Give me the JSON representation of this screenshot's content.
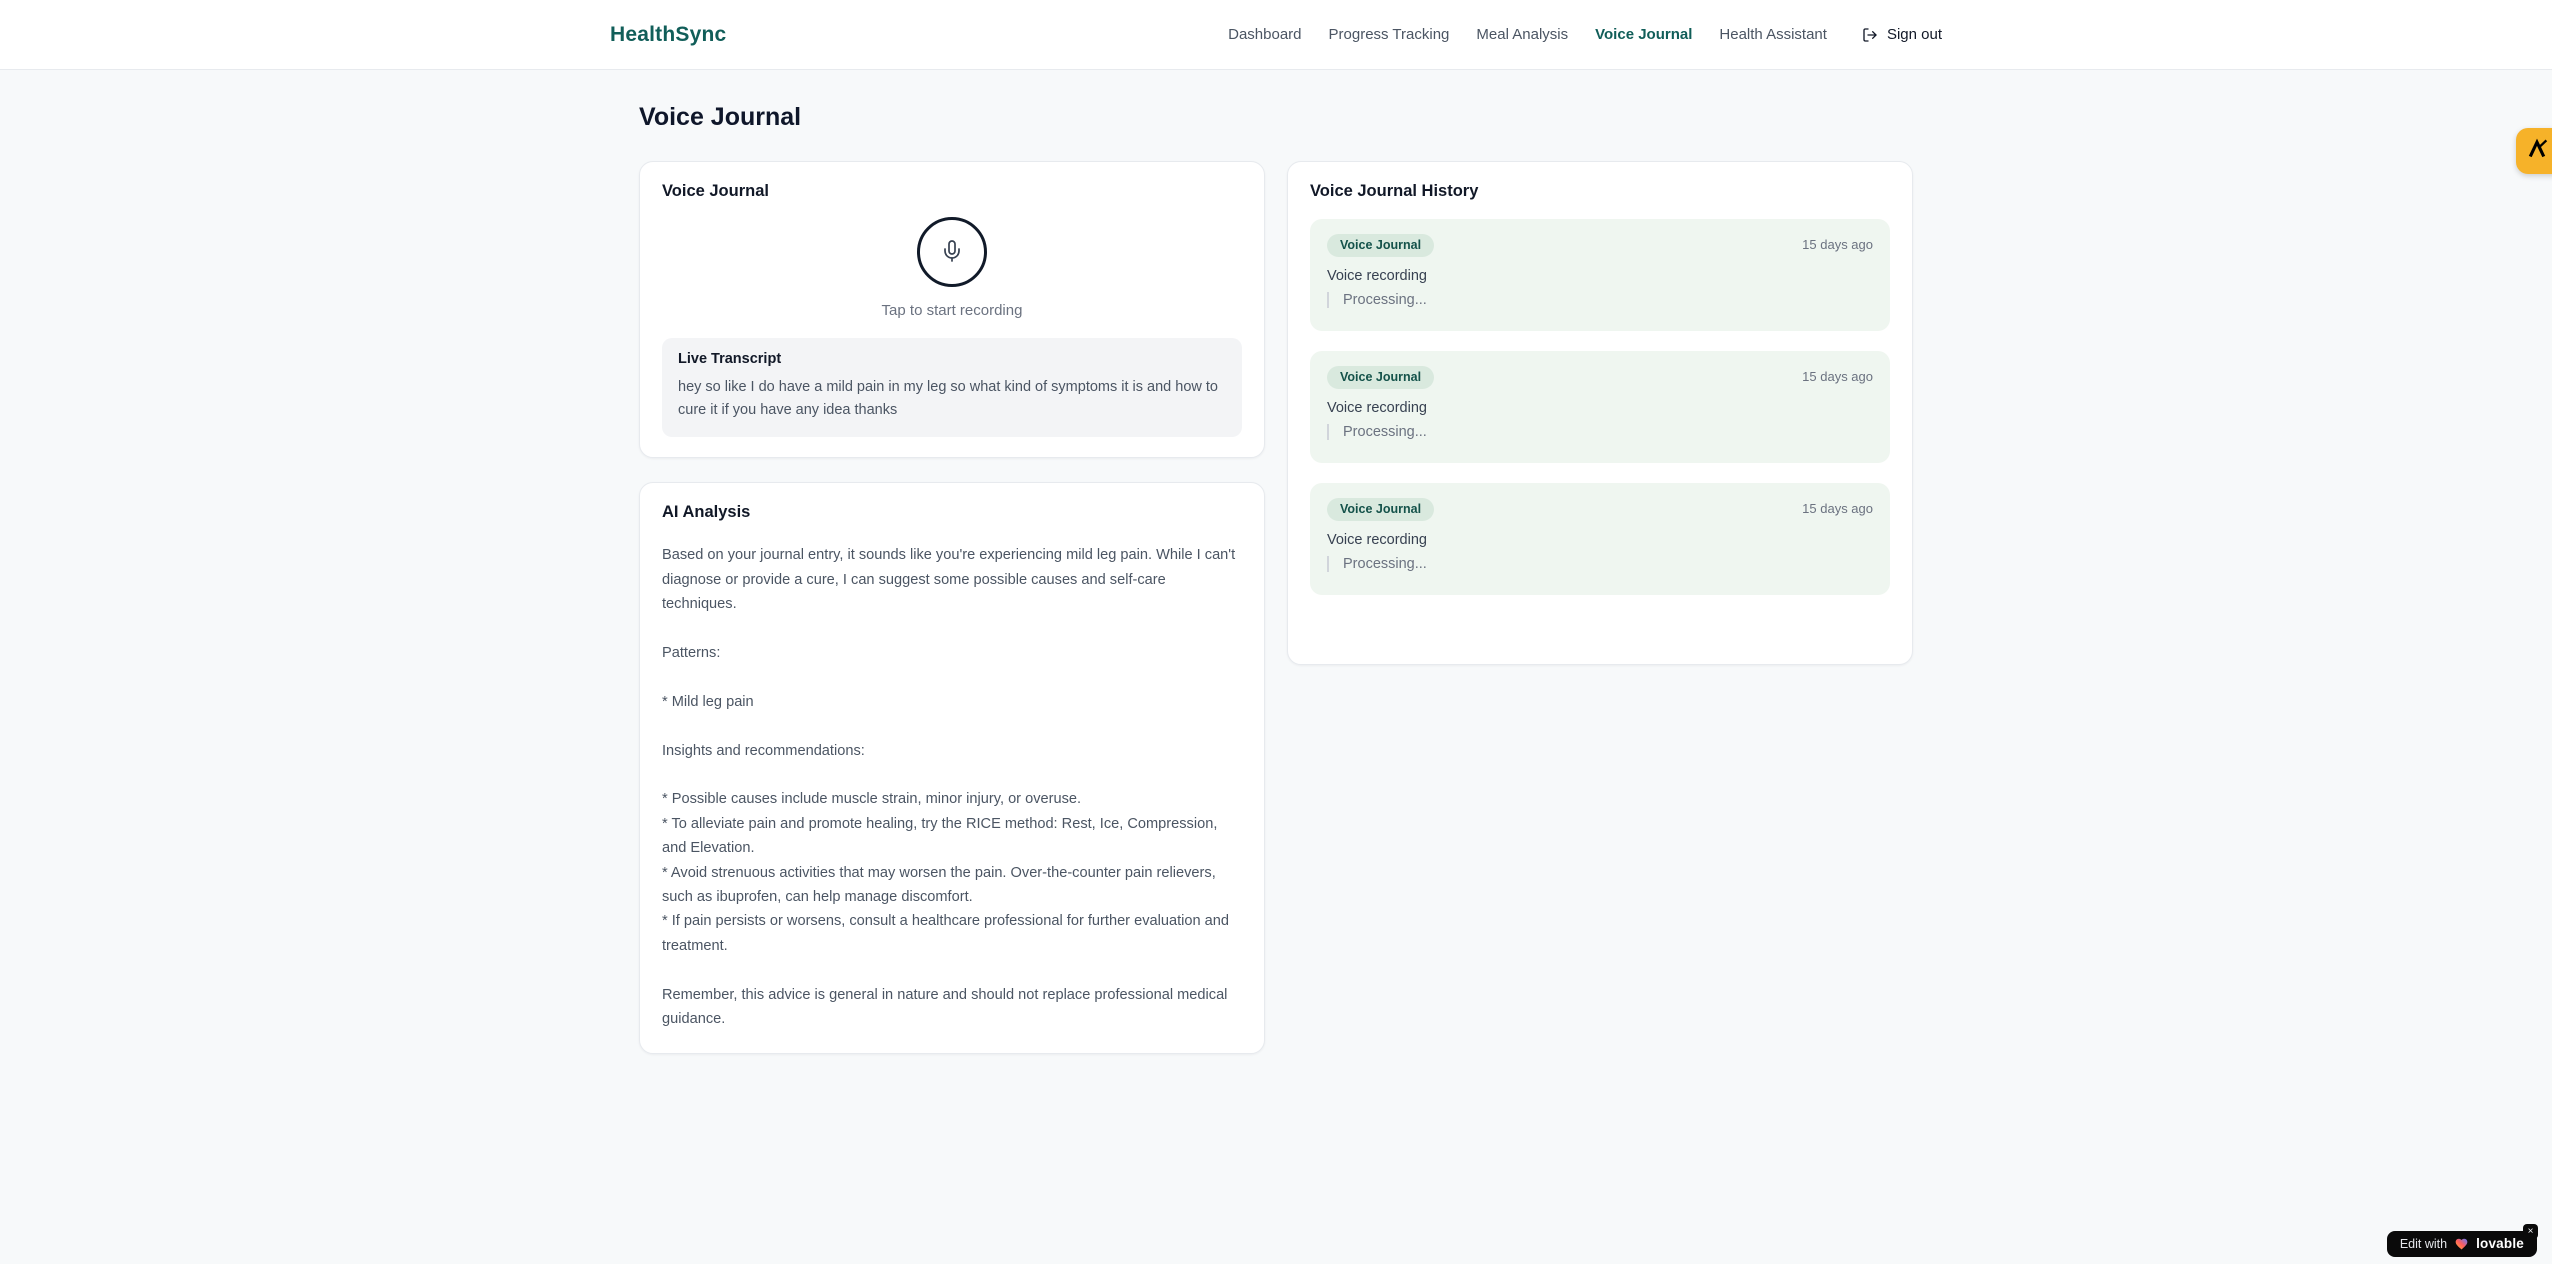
{
  "header": {
    "brand": "HealthSync",
    "nav": [
      {
        "label": "Dashboard",
        "active": false
      },
      {
        "label": "Progress Tracking",
        "active": false
      },
      {
        "label": "Meal Analysis",
        "active": false
      },
      {
        "label": "Voice Journal",
        "active": true
      },
      {
        "label": "Health Assistant",
        "active": false
      }
    ],
    "sign_out_label": "Sign out"
  },
  "page": {
    "title": "Voice Journal"
  },
  "recorder": {
    "card_title": "Voice Journal",
    "tap_hint": "Tap to start recording",
    "transcript": {
      "title": "Live Transcript",
      "text": "hey so like I do have a mild pain in my leg so what kind of symptoms it is and how to cure it if you have any idea thanks"
    }
  },
  "ai_analysis": {
    "card_title": "AI Analysis",
    "paragraphs": [
      "Based on your journal entry, it sounds like you're experiencing mild leg pain. While I can't diagnose or provide a cure, I can suggest some possible causes and self-care techniques.",
      "Patterns:",
      "* Mild leg pain",
      "Insights and recommendations:",
      "* Possible causes include muscle strain, minor injury, or overuse.\n* To alleviate pain and promote healing, try the RICE method: Rest, Ice, Compression, and Elevation.\n* Avoid strenuous activities that may worsen the pain. Over-the-counter pain relievers, such as ibuprofen, can help manage discomfort.\n* If pain persists or worsens, consult a healthcare professional for further evaluation and treatment.",
      "Remember, this advice is general in nature and should not replace professional medical guidance."
    ]
  },
  "history": {
    "card_title": "Voice Journal History",
    "entries": [
      {
        "badge": "Voice Journal",
        "time": "15 days ago",
        "title": "Voice recording",
        "status": "Processing..."
      },
      {
        "badge": "Voice Journal",
        "time": "15 days ago",
        "title": "Voice recording",
        "status": "Processing..."
      },
      {
        "badge": "Voice Journal",
        "time": "15 days ago",
        "title": "Voice recording",
        "status": "Processing..."
      }
    ]
  },
  "overlays": {
    "lovable_badge": {
      "prefix": "Edit with",
      "brand": "lovable",
      "close": "×"
    }
  },
  "colors": {
    "brand_teal": "#115e59",
    "page_bg": "#f7f9fa",
    "entry_bg": "#eff6f0",
    "badge_bg": "#d9e9de",
    "badge_text": "#14524a",
    "launcher_amber": "#f6b229",
    "lovable_bg": "#0a0a0a"
  }
}
